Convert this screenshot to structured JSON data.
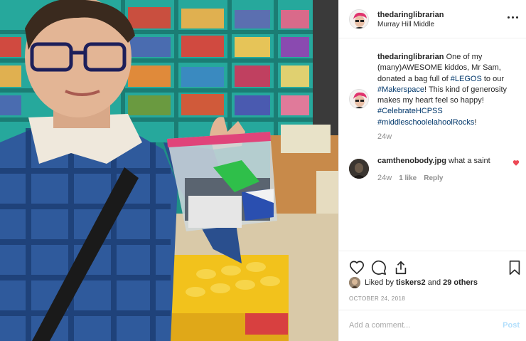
{
  "header": {
    "username": "thedaringlibrarian",
    "location": "Murray Hill Middle",
    "more_icon": "more-horizontal-icon"
  },
  "caption": {
    "username": "thedaringlibrarian",
    "text_1": "One of my (many)AWESOME kiddos, Mr Sam, donated a bag full of",
    "tag_legos": "#LEGOS",
    "text_2": "to our",
    "tag_makerspace": "#Makerspace",
    "text_3": "! This kind of generosity makes my heart feel so happy!",
    "tag_celebrate": "#CelebrateHCPSS",
    "tag_middleschool": "#middleschoolelahoolRocks",
    "text_4": "!",
    "age": "24w"
  },
  "comment": {
    "username": "camthenobody.jpg",
    "text": "what a saint",
    "age": "24w",
    "likes": "1 like",
    "reply": "Reply",
    "heart_color": "#ed4956"
  },
  "actions": {
    "icons": [
      "heart-icon",
      "comment-icon",
      "share-icon",
      "bookmark-icon"
    ]
  },
  "likes": {
    "prefix": "Liked by",
    "user": "tiskers2",
    "middle": "and",
    "others": "29 others"
  },
  "post_date": "OCTOBER 24, 2018",
  "add_comment": {
    "placeholder": "Add a comment...",
    "post_label": "Post"
  },
  "colors": {
    "link": "#00376b",
    "muted": "#8e8e8e",
    "post_disabled": "#b2dffc"
  }
}
